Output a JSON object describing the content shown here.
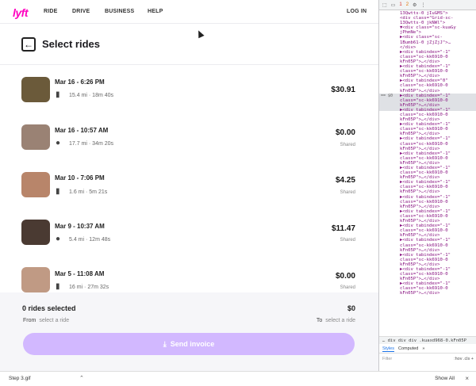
{
  "nav": {
    "logo": "lyft",
    "links": [
      "RIDE",
      "DRIVE",
      "BUSINESS",
      "HELP"
    ],
    "login": "LOG IN"
  },
  "page": {
    "back_icon": "←",
    "title": "Select rides"
  },
  "rides": [
    {
      "date": "Mar 16 - 6:26 PM",
      "icon": "luggage-icon",
      "meta": "15.4 mi · 18m 40s",
      "price": "$30.91",
      "shared": "",
      "avatar_color": "#6b5a3a"
    },
    {
      "date": "Mar 16 - 10:57 AM",
      "icon": "person-icon",
      "meta": "17.7 mi · 34m 20s",
      "price": "$0.00",
      "shared": "Shared",
      "avatar_color": "#9a8274"
    },
    {
      "date": "Mar 10 - 7:06 PM",
      "icon": "luggage-icon",
      "meta": "1.6 mi · 5m 21s",
      "price": "$4.25",
      "shared": "Shared",
      "avatar_color": "#b8856a"
    },
    {
      "date": "Mar 9 - 10:37 AM",
      "icon": "person-icon",
      "meta": "5.4 mi · 12m 48s",
      "price": "$11.47",
      "shared": "Shared",
      "avatar_color": "#4a3a32"
    },
    {
      "date": "Mar 5 - 11:08 AM",
      "icon": "luggage-icon",
      "meta": "16 mi · 27m 32s",
      "price": "$0.00",
      "shared": "Shared",
      "avatar_color": "#c09a84"
    }
  ],
  "footer": {
    "selected": "0 rides selected",
    "total": "$0",
    "from_label": "From",
    "from_hint": "select a ride",
    "to_label": "To",
    "to_hint": "select a ride",
    "send_button": "Send invoice"
  },
  "devtools": {
    "tree": [
      "13Qwtts-0 jIuGMS\">",
      "<div class=\"Grid-sc-",
      "13Qwtts-0 jkNWl\">",
      "▼<div class=\"sc-kuaGy",
      "jPhmNe\">",
      "▶<div class=\"sc-",
      "1Bumb61-0 jZjZjJ\">…",
      "</div>",
      "▶<div tabindex=\"-1\"",
      "class=\"sc-kk6910-0",
      "kFn05P\">…</div>",
      "▶<div tabindex=\"-1\"",
      "class=\"sc-kk6910-0",
      "kFn05P\">…</div>",
      "▶<div tabindex=\"0\"",
      "class=\"sc-kk6910-0",
      "kFn05P\">…</div>",
      "▶<div tabindex=\"-1\"",
      "class=\"sc-kk6910-0",
      "kFn05P\">…</div>",
      "▶<div tabindex=\"-1\"",
      "class=\"sc-kk6910-0",
      "kFn05P\">…</div>",
      "▶<div tabindex=\"-1\"",
      "class=\"sc-kk6910-0",
      "kFn05P\">…</div>",
      "▶<div tabindex=\"-1\"",
      "class=\"sc-kk6910-0",
      "kFn05P\">…</div>",
      "▶<div tabindex=\"-1\"",
      "class=\"sc-kk6910-0",
      "kFn05P\">…</div>",
      "▶<div tabindex=\"-1\"",
      "class=\"sc-kk6910-0",
      "kFn05P\">…</div>",
      "▶<div tabindex=\"-1\"",
      "class=\"sc-kk6910-0",
      "kFn05P\">…</div>",
      "▶<div tabindex=\"-1\"",
      "class=\"sc-kk6910-0",
      "kFn05P\">…</div>",
      "▶<div tabindex=\"-1\"",
      "class=\"sc-kk6910-0",
      "kFn05P\">…</div>",
      "▶<div tabindex=\"-1\"",
      "class=\"sc-kk6910-0",
      "kFn05P\">…</div>",
      "▶<div tabindex=\"-1\"",
      "class=\"sc-kk6910-0",
      "kFn05P\">…</div>",
      "▶<div tabindex=\"-1\"",
      "class=\"sc-kk6910-0",
      "kFn05P\">…</div>",
      "▶<div tabindex=\"-1\"",
      "class=\"sc-kk6910-0",
      "kFn05P\">…</div>",
      "▶<div tabindex=\"-1\"",
      "class=\"sc-kk6910-0",
      "kFn05P\">…</div>"
    ],
    "gutter": "== $0",
    "crumbs": "…  div  div  div  .kuaxd968-0.kFn05P",
    "tabs": [
      "Styles",
      "Computed",
      "»"
    ],
    "filter": "Filter",
    "filter_right": ":hov .cls +",
    "counts": {
      "errors": "1",
      "warnings": "2"
    }
  },
  "downloads": {
    "file": "Step 3.gif",
    "show_all": "Show All",
    "close_icon": "×"
  }
}
